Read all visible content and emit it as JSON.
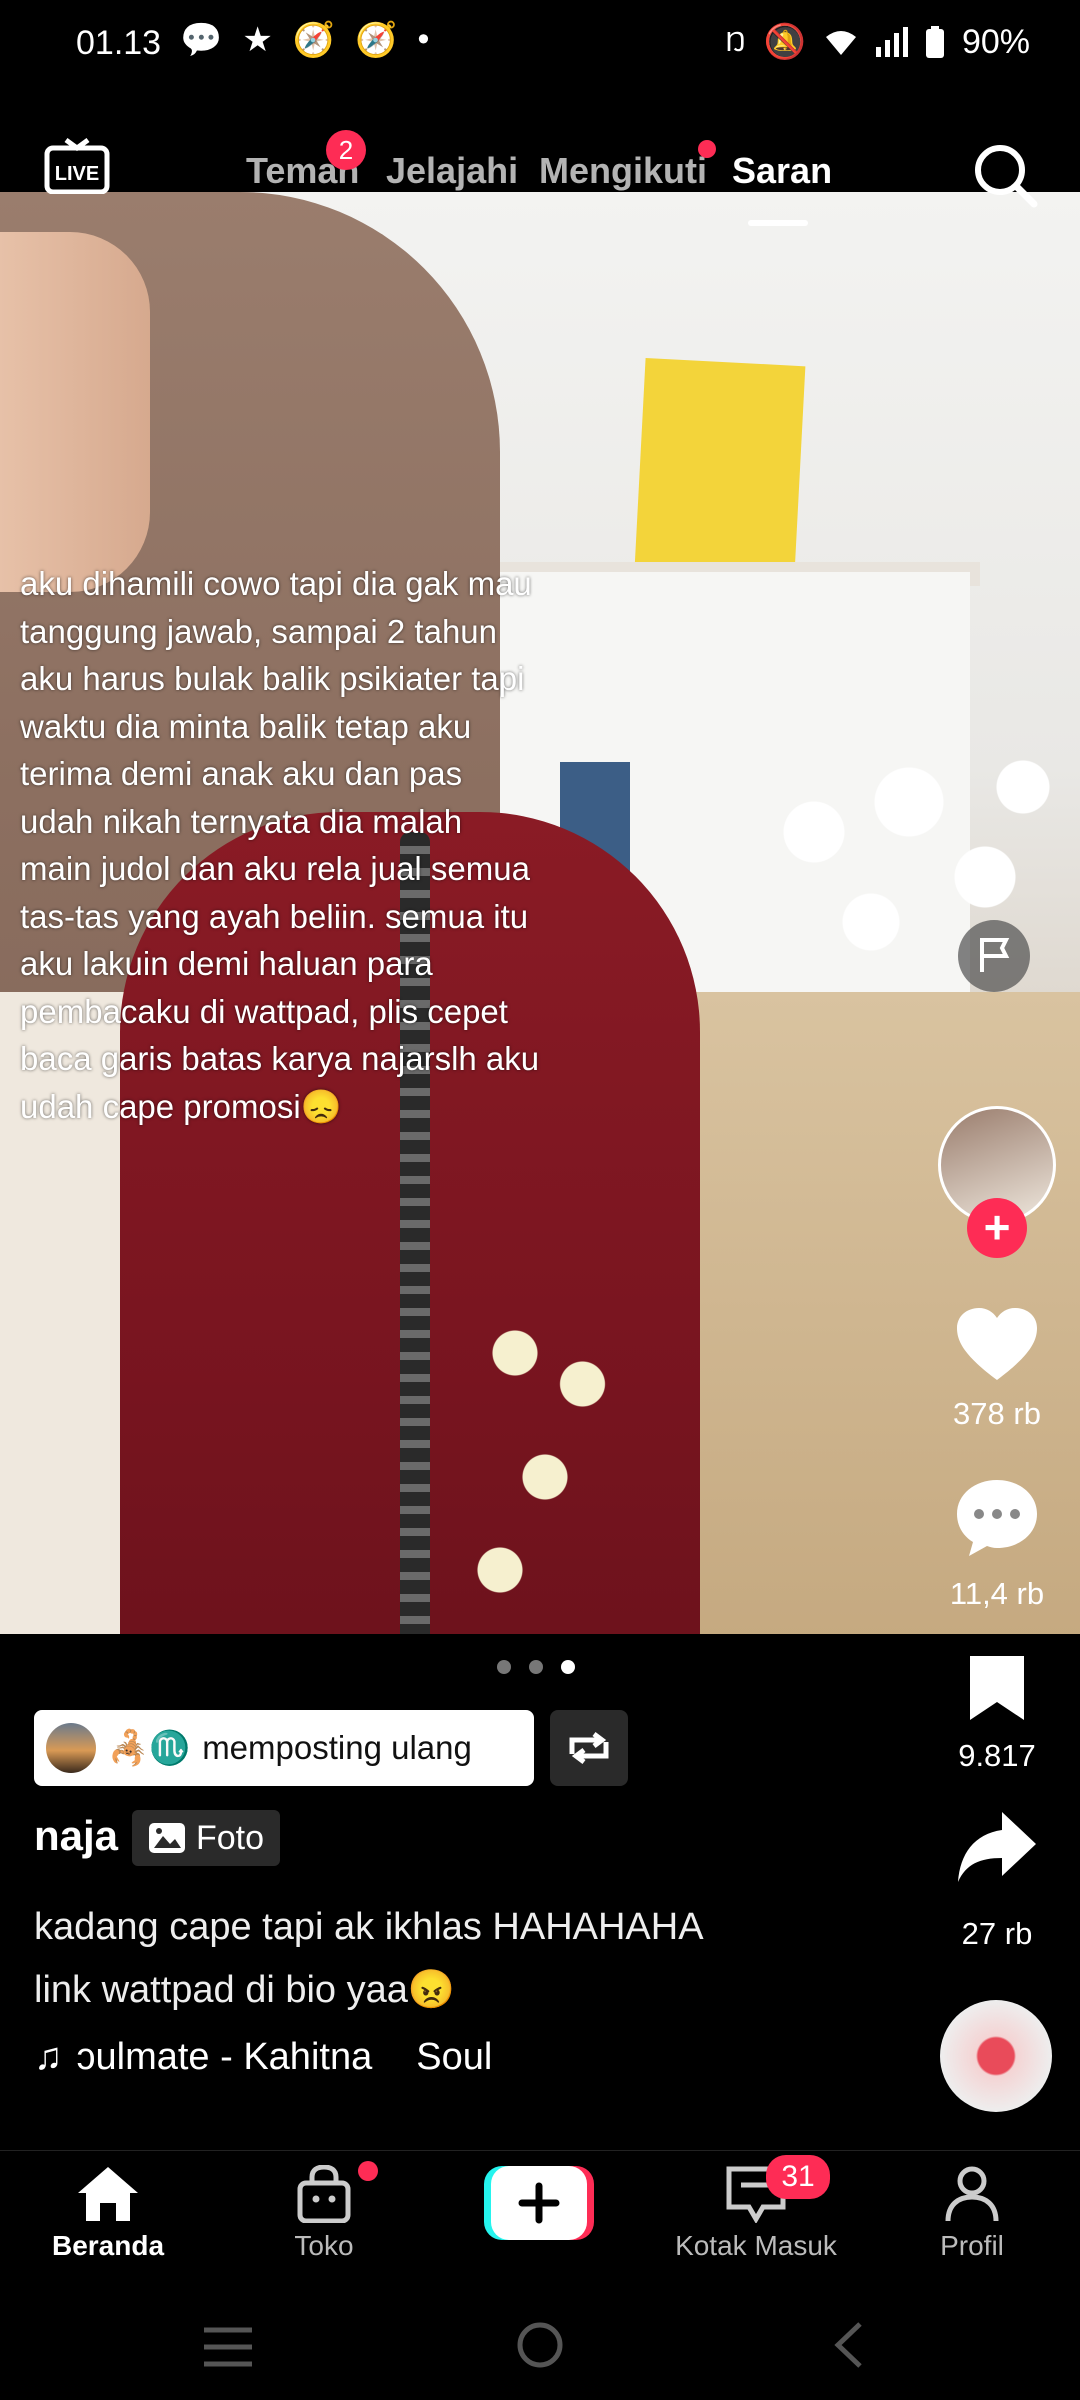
{
  "status_bar": {
    "time": "01.13",
    "battery": "90%",
    "left_icons": [
      "chat-bubble-icon",
      "star-icon",
      "compass-icon",
      "compass-icon",
      "dot-icon"
    ],
    "right_icons": [
      "nfc-icon",
      "mute-icon",
      "wifi-icon",
      "signal-icon",
      "battery-icon"
    ]
  },
  "top_nav": {
    "live_label": "LIVE",
    "tabs": [
      {
        "label": "Teman",
        "badge": "2"
      },
      {
        "label": "Jelajahi"
      },
      {
        "label": "Mengikuti",
        "dot": true
      },
      {
        "label": "Saran",
        "active": true
      }
    ]
  },
  "post": {
    "overlay_text": "aku dihamili cowo tapi dia gak mau tanggung jawab, sampai 2 tahun aku harus bulak balik psikiater tapi waktu dia minta balik tetap aku terima demi anak aku dan pas udah nikah ternyata dia malah main judol dan aku rela jual semua tas-tas yang ayah beliin. semua itu aku lakuin demi haluan para pembacaku di wattpad, plis cepet baca garis batas karya najarslh aku udah cape promosi😞",
    "carousel": {
      "count": 3,
      "active_index": 2
    },
    "repost_label": "memposting ulang",
    "repost_emojis": "🦂♏",
    "author": "naja",
    "type_chip": "Foto",
    "caption_line1": "kadang cape tapi ak ikhlas HAHAHAHA",
    "caption_line2": "link wattpad di bio yaa😠",
    "music": "ɔulmate - Kahitna",
    "music_artist": "Soul"
  },
  "rail": {
    "likes": "378 rb",
    "comments": "11,4 rb",
    "saves": "9.817",
    "shares": "27 rb"
  },
  "bottom_nav": {
    "items": [
      {
        "label": "Beranda",
        "active": true
      },
      {
        "label": "Toko",
        "dot": true
      },
      {
        "label": "Kotak Masuk",
        "badge": "31"
      },
      {
        "label": "Profil"
      }
    ]
  },
  "colors": {
    "accent": "#fe2c55",
    "cyan": "#25f4ee"
  }
}
